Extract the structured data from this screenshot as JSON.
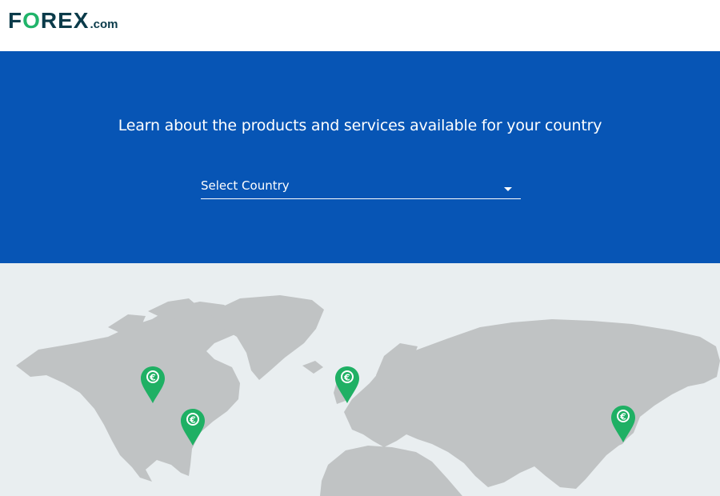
{
  "header": {
    "logo": {
      "main_prefix": "F",
      "main_accent": "O",
      "main_rest": "REX",
      "suffix": ".com"
    }
  },
  "hero": {
    "title": "Learn about the products and services available for your country",
    "select": {
      "selected_value": "Select Country"
    }
  },
  "map": {
    "pins": [
      {
        "name": "map-pin-canada",
        "icon": "currency-icon"
      },
      {
        "name": "map-pin-usa",
        "icon": "currency-icon"
      },
      {
        "name": "map-pin-uk",
        "icon": "currency-icon"
      },
      {
        "name": "map-pin-japan",
        "icon": "currency-icon"
      }
    ]
  },
  "colors": {
    "brand_dark": "#0b3b4a",
    "brand_green": "#20b46a",
    "hero_blue": "#0755b5",
    "map_land": "#c0c3c4",
    "map_bg": "#e9eef0",
    "pin_green": "#1fb064"
  }
}
